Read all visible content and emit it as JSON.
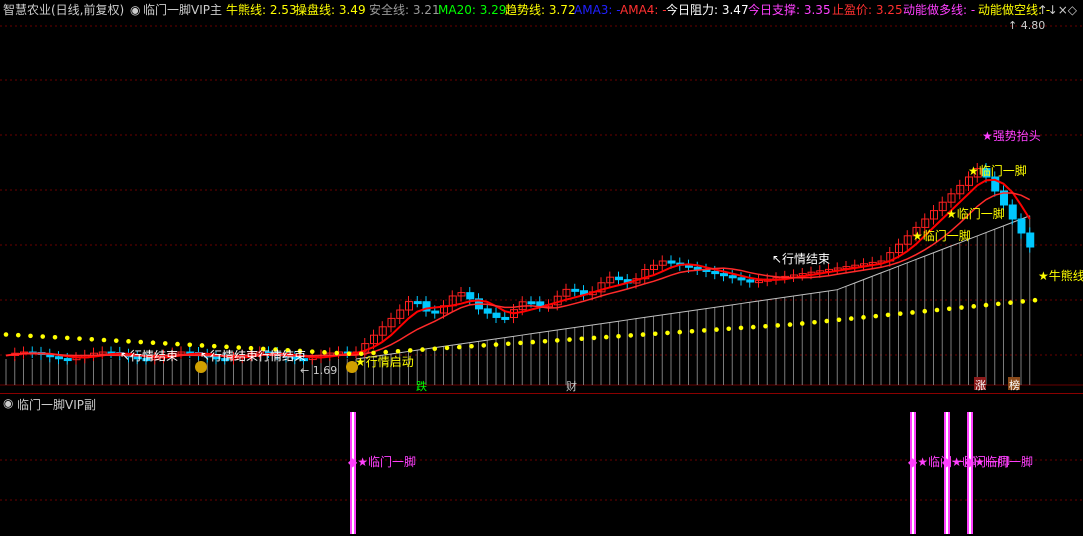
{
  "main_header": {
    "stock": "智慧农业(日线,前复权)",
    "indicator": "临门一脚VIP主",
    "items": [
      {
        "text": "牛熊线: 2.53",
        "color": "#ffff00"
      },
      {
        "text": "操盘线: 3.49",
        "color": "#ffff00"
      },
      {
        "text": "安全线: 3.21",
        "color": "#9a9a9a"
      },
      {
        "text": "MA20: 3.29",
        "color": "#00ff00"
      },
      {
        "text": "趋势线: 3.72",
        "color": "#ffff00"
      },
      {
        "text": "AMA3: -",
        "color": "#2020ff"
      },
      {
        "text": "AMA4: -",
        "color": "#ff3030"
      },
      {
        "text": "今日阻力: 3.47",
        "color": "#ffffff"
      },
      {
        "text": "今日支撑: 3.35",
        "color": "#ff40ff"
      },
      {
        "text": "止盈价: 3.25",
        "color": "#ff3030"
      },
      {
        "text": "动能做多线: -",
        "color": "#ff40ff"
      },
      {
        "text": "动能做空线: -",
        "color": "#ffff00"
      }
    ],
    "controls": "↑↓×◇"
  },
  "sub_header": {
    "indicator": "临门一脚VIP副"
  },
  "chart_data": {
    "type": "candlestick",
    "price_high_label": "4.80",
    "price_low_label": "1.69",
    "line_label_bull": "牛熊线",
    "annotations": [
      "行情结束",
      "行情结束",
      "行情结束",
      "临门一脚",
      "临门一脚",
      "临门一脚",
      "临门一脚",
      "行情启动",
      "行情启动",
      "强势抬头",
      "跌",
      "财",
      "涨",
      "榜"
    ],
    "sub_signal_label": "临门一脚",
    "colors": {
      "up": "#ff2020",
      "down": "#00c8ff",
      "bull_bear_line": "#ffff00",
      "operate_line": "#ff0000",
      "safe_line": "#9a9a9a"
    }
  }
}
